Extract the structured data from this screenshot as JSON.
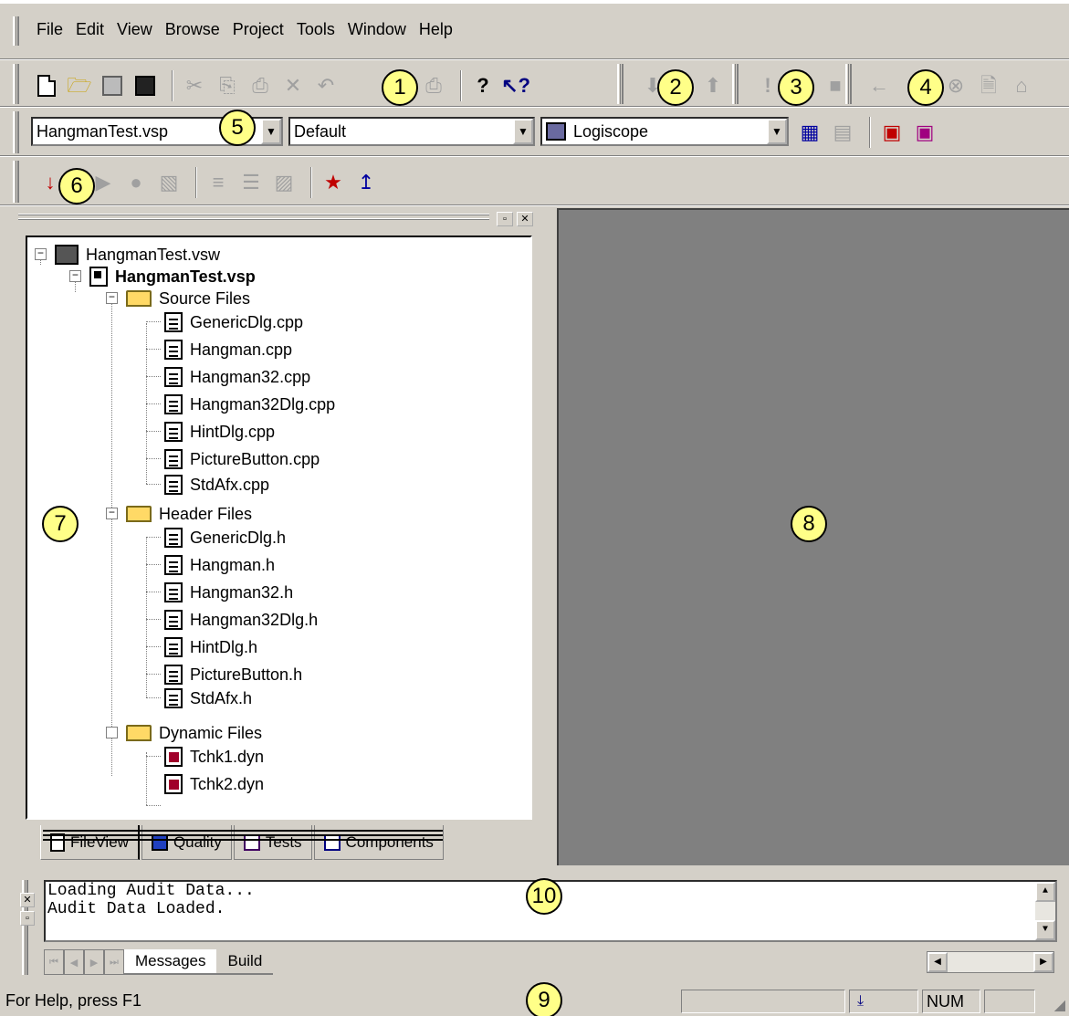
{
  "menu": [
    "File",
    "Edit",
    "View",
    "Browse",
    "Project",
    "Tools",
    "Window",
    "Help"
  ],
  "callouts": [
    "1",
    "2",
    "3",
    "4",
    "5",
    "6",
    "7",
    "8",
    "9",
    "10"
  ],
  "build_toolbar": {
    "project_combo": "HangmanTest.vsp",
    "config_combo": "Default",
    "tool_combo": "Logiscope"
  },
  "tree": {
    "workspace": "HangmanTest.vsw",
    "project": "HangmanTest.vsp",
    "groups": [
      {
        "name": "Source Files",
        "files": [
          "GenericDlg.cpp",
          "Hangman.cpp",
          "Hangman32.cpp",
          "Hangman32Dlg.cpp",
          "HintDlg.cpp",
          "PictureButton.cpp",
          "StdAfx.cpp"
        ]
      },
      {
        "name": "Header Files",
        "files": [
          "GenericDlg.h",
          "Hangman.h",
          "Hangman32.h",
          "Hangman32Dlg.h",
          "HintDlg.h",
          "PictureButton.h",
          "StdAfx.h"
        ]
      },
      {
        "name": "Dynamic Files",
        "files": [
          "Tchk1.dyn",
          "Tchk2.dyn"
        ]
      }
    ]
  },
  "workspace_tabs": [
    "FileView",
    "Quality",
    "Tests",
    "Components"
  ],
  "output": {
    "lines": [
      "Loading Audit Data...",
      "Audit Data Loaded."
    ],
    "tabs": [
      "Messages",
      "Build"
    ]
  },
  "status": {
    "message": "For Help, press F1",
    "num": "NUM"
  },
  "colors": {
    "face": "#d4d0c8",
    "callout": "#ffff88",
    "mdi": "#808080"
  }
}
